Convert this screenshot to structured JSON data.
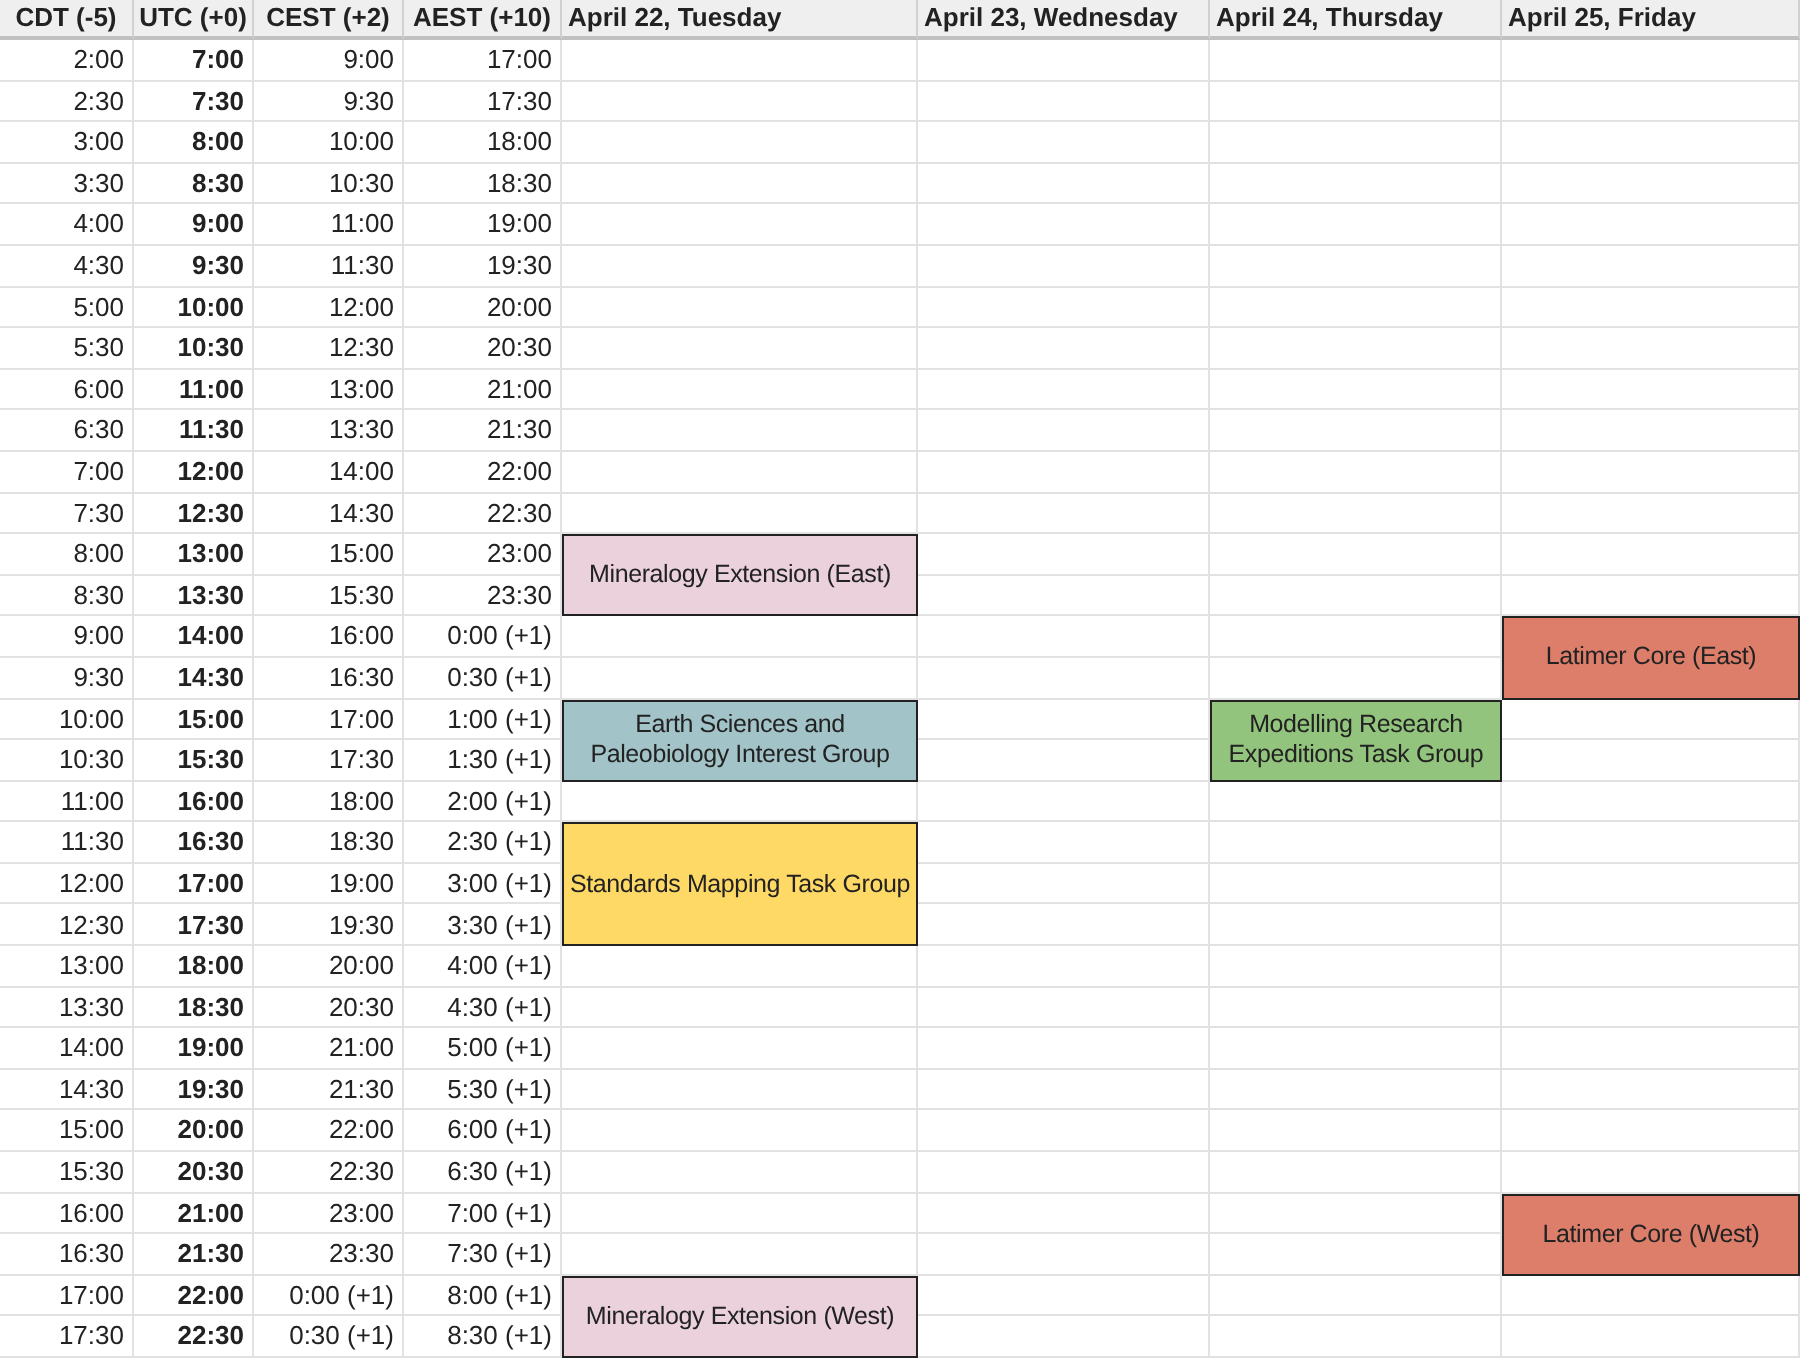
{
  "columns": [
    "CDT (-5)",
    "UTC (+0)",
    "CEST (+2)",
    "AEST (+10)",
    "April 22, Tuesday",
    "April 23, Wednesday",
    "April 24, Thursday",
    "April 25, Friday"
  ],
  "rows": [
    {
      "times": [
        "2:00",
        "7:00",
        "9:00",
        "17:00"
      ],
      "slots": [
        {
          "kind": "empty"
        },
        {
          "kind": "empty"
        },
        {
          "kind": "empty"
        },
        {
          "kind": "empty"
        }
      ]
    },
    {
      "times": [
        "2:30",
        "7:30",
        "9:30",
        "17:30"
      ],
      "slots": [
        {
          "kind": "empty"
        },
        {
          "kind": "empty"
        },
        {
          "kind": "empty"
        },
        {
          "kind": "empty"
        }
      ]
    },
    {
      "times": [
        "3:00",
        "8:00",
        "10:00",
        "18:00"
      ],
      "slots": [
        {
          "kind": "empty"
        },
        {
          "kind": "empty"
        },
        {
          "kind": "empty"
        },
        {
          "kind": "empty"
        }
      ]
    },
    {
      "times": [
        "3:30",
        "8:30",
        "10:30",
        "18:30"
      ],
      "slots": [
        {
          "kind": "empty"
        },
        {
          "kind": "empty"
        },
        {
          "kind": "empty"
        },
        {
          "kind": "empty"
        }
      ]
    },
    {
      "times": [
        "4:00",
        "9:00",
        "11:00",
        "19:00"
      ],
      "slots": [
        {
          "kind": "empty"
        },
        {
          "kind": "empty"
        },
        {
          "kind": "empty"
        },
        {
          "kind": "empty"
        }
      ]
    },
    {
      "times": [
        "4:30",
        "9:30",
        "11:30",
        "19:30"
      ],
      "slots": [
        {
          "kind": "empty"
        },
        {
          "kind": "empty"
        },
        {
          "kind": "empty"
        },
        {
          "kind": "empty"
        }
      ]
    },
    {
      "times": [
        "5:00",
        "10:00",
        "12:00",
        "20:00"
      ],
      "slots": [
        {
          "kind": "empty"
        },
        {
          "kind": "empty"
        },
        {
          "kind": "empty"
        },
        {
          "kind": "empty"
        }
      ]
    },
    {
      "times": [
        "5:30",
        "10:30",
        "12:30",
        "20:30"
      ],
      "slots": [
        {
          "kind": "empty"
        },
        {
          "kind": "empty"
        },
        {
          "kind": "empty"
        },
        {
          "kind": "empty"
        }
      ]
    },
    {
      "times": [
        "6:00",
        "11:00",
        "13:00",
        "21:00"
      ],
      "slots": [
        {
          "kind": "empty"
        },
        {
          "kind": "empty"
        },
        {
          "kind": "empty"
        },
        {
          "kind": "empty"
        }
      ]
    },
    {
      "times": [
        "6:30",
        "11:30",
        "13:30",
        "21:30"
      ],
      "slots": [
        {
          "kind": "empty"
        },
        {
          "kind": "empty"
        },
        {
          "kind": "empty"
        },
        {
          "kind": "empty"
        }
      ]
    },
    {
      "times": [
        "7:00",
        "12:00",
        "14:00",
        "22:00"
      ],
      "slots": [
        {
          "kind": "empty"
        },
        {
          "kind": "empty"
        },
        {
          "kind": "empty"
        },
        {
          "kind": "empty"
        }
      ]
    },
    {
      "times": [
        "7:30",
        "12:30",
        "14:30",
        "22:30"
      ],
      "slots": [
        {
          "kind": "empty"
        },
        {
          "kind": "empty"
        },
        {
          "kind": "empty"
        },
        {
          "kind": "empty"
        }
      ]
    },
    {
      "times": [
        "8:00",
        "13:00",
        "15:00",
        "23:00"
      ],
      "slots": [
        {
          "kind": "event",
          "label": "Mineralogy Extension (East)",
          "color": "#ead1dc"
        },
        {
          "kind": "empty"
        },
        {
          "kind": "empty"
        },
        {
          "kind": "empty"
        }
      ]
    },
    {
      "times": [
        "8:30",
        "13:30",
        "15:30",
        "23:30"
      ],
      "slots": [
        {
          "kind": "covered"
        },
        {
          "kind": "empty"
        },
        {
          "kind": "empty"
        },
        {
          "kind": "empty"
        }
      ]
    },
    {
      "times": [
        "9:00",
        "14:00",
        "16:00",
        "0:00 (+1)"
      ],
      "slots": [
        {
          "kind": "empty"
        },
        {
          "kind": "empty"
        },
        {
          "kind": "empty"
        },
        {
          "kind": "event",
          "label": "Latimer Core (East)",
          "color": "#dd7e6b"
        }
      ]
    },
    {
      "times": [
        "9:30",
        "14:30",
        "16:30",
        "0:30 (+1)"
      ],
      "slots": [
        {
          "kind": "empty"
        },
        {
          "kind": "empty"
        },
        {
          "kind": "empty"
        },
        {
          "kind": "covered"
        }
      ]
    },
    {
      "times": [
        "10:00",
        "15:00",
        "17:00",
        "1:00 (+1)"
      ],
      "slots": [
        {
          "kind": "event",
          "label": "Earth Sciences and Paleobiology Interest Group",
          "color": "#a2c4c9"
        },
        {
          "kind": "empty"
        },
        {
          "kind": "event",
          "label": "Modelling Research Expeditions Task Group",
          "color": "#93c47d"
        },
        {
          "kind": "empty"
        }
      ]
    },
    {
      "times": [
        "10:30",
        "15:30",
        "17:30",
        "1:30 (+1)"
      ],
      "slots": [
        {
          "kind": "covered"
        },
        {
          "kind": "empty"
        },
        {
          "kind": "covered"
        },
        {
          "kind": "empty"
        }
      ]
    },
    {
      "times": [
        "11:00",
        "16:00",
        "18:00",
        "2:00 (+1)"
      ],
      "slots": [
        {
          "kind": "empty"
        },
        {
          "kind": "empty"
        },
        {
          "kind": "empty"
        },
        {
          "kind": "empty"
        }
      ]
    },
    {
      "times": [
        "11:30",
        "16:30",
        "18:30",
        "2:30 (+1)"
      ],
      "slots": [
        {
          "kind": "event",
          "label": "Standards Mapping Task Group",
          "color": "#ffd966"
        },
        {
          "kind": "empty"
        },
        {
          "kind": "empty"
        },
        {
          "kind": "empty"
        }
      ]
    },
    {
      "times": [
        "12:00",
        "17:00",
        "19:00",
        "3:00 (+1)"
      ],
      "slots": [
        {
          "kind": "covered"
        },
        {
          "kind": "empty"
        },
        {
          "kind": "empty"
        },
        {
          "kind": "empty"
        }
      ]
    },
    {
      "times": [
        "12:30",
        "17:30",
        "19:30",
        "3:30 (+1)"
      ],
      "slots": [
        {
          "kind": "covered"
        },
        {
          "kind": "empty"
        },
        {
          "kind": "empty"
        },
        {
          "kind": "empty"
        }
      ]
    },
    {
      "times": [
        "13:00",
        "18:00",
        "20:00",
        "4:00 (+1)"
      ],
      "slots": [
        {
          "kind": "empty"
        },
        {
          "kind": "empty"
        },
        {
          "kind": "empty"
        },
        {
          "kind": "empty"
        }
      ]
    },
    {
      "times": [
        "13:30",
        "18:30",
        "20:30",
        "4:30 (+1)"
      ],
      "slots": [
        {
          "kind": "empty"
        },
        {
          "kind": "empty"
        },
        {
          "kind": "empty"
        },
        {
          "kind": "empty"
        }
      ]
    },
    {
      "times": [
        "14:00",
        "19:00",
        "21:00",
        "5:00 (+1)"
      ],
      "slots": [
        {
          "kind": "empty"
        },
        {
          "kind": "empty"
        },
        {
          "kind": "empty"
        },
        {
          "kind": "empty"
        }
      ]
    },
    {
      "times": [
        "14:30",
        "19:30",
        "21:30",
        "5:30 (+1)"
      ],
      "slots": [
        {
          "kind": "empty"
        },
        {
          "kind": "empty"
        },
        {
          "kind": "empty"
        },
        {
          "kind": "empty"
        }
      ]
    },
    {
      "times": [
        "15:00",
        "20:00",
        "22:00",
        "6:00 (+1)"
      ],
      "slots": [
        {
          "kind": "empty"
        },
        {
          "kind": "empty"
        },
        {
          "kind": "empty"
        },
        {
          "kind": "empty"
        }
      ]
    },
    {
      "times": [
        "15:30",
        "20:30",
        "22:30",
        "6:30 (+1)"
      ],
      "slots": [
        {
          "kind": "empty"
        },
        {
          "kind": "empty"
        },
        {
          "kind": "empty"
        },
        {
          "kind": "empty"
        }
      ]
    },
    {
      "times": [
        "16:00",
        "21:00",
        "23:00",
        "7:00 (+1)"
      ],
      "slots": [
        {
          "kind": "empty"
        },
        {
          "kind": "empty"
        },
        {
          "kind": "empty"
        },
        {
          "kind": "event",
          "label": "Latimer Core (West)",
          "color": "#dd7e6b"
        }
      ]
    },
    {
      "times": [
        "16:30",
        "21:30",
        "23:30",
        "7:30 (+1)"
      ],
      "slots": [
        {
          "kind": "empty"
        },
        {
          "kind": "empty"
        },
        {
          "kind": "empty"
        },
        {
          "kind": "covered"
        }
      ]
    },
    {
      "times": [
        "17:00",
        "22:00",
        "0:00 (+1)",
        "8:00 (+1)"
      ],
      "slots": [
        {
          "kind": "event",
          "label": "Mineralogy Extension (West)",
          "color": "#ead1dc"
        },
        {
          "kind": "empty"
        },
        {
          "kind": "empty"
        },
        {
          "kind": "empty"
        }
      ]
    },
    {
      "times": [
        "17:30",
        "22:30",
        "0:30 (+1)",
        "8:30 (+1)"
      ],
      "slots": [
        {
          "kind": "covered"
        },
        {
          "kind": "empty"
        },
        {
          "kind": "empty"
        },
        {
          "kind": "empty"
        }
      ]
    }
  ]
}
